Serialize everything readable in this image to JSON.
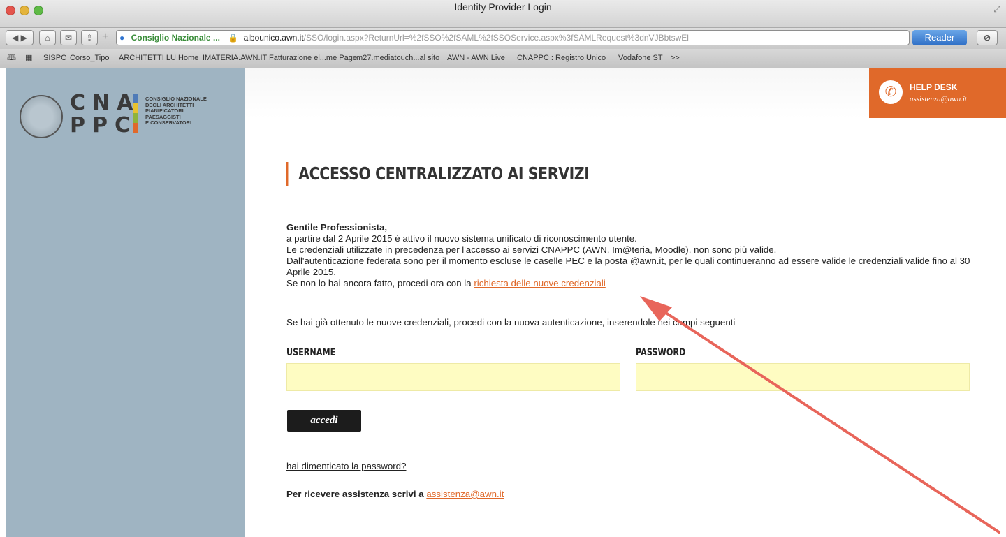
{
  "browser": {
    "window_title": "Identity Provider Login",
    "address": {
      "org": "Consiglio Nazionale ...",
      "host": "albounico.awn.it",
      "path": "/SSO/login.aspx?ReturnUrl=%2fSSO%2fSAML%2fSSOService.aspx%3fSAMLRequest%3dnVJBbtswEl"
    },
    "reader_label": "Reader",
    "bookmarks": [
      "SISPC",
      "Corso_Tipo",
      "ARCHITETTI LU Home",
      "IMATERIA.AWN.IT",
      "Fatturazione el...me Page",
      "m27.mediatouch...al sito",
      "AWN - AWN Live",
      "CNAPPC : Registro Unico",
      "Vodafone ST",
      ">>"
    ]
  },
  "logo": {
    "letters_top": "CNA",
    "letters_bottom": "PPC",
    "subtitle_lines": [
      "CONSIGLIO NAZIONALE",
      "DEGLI ARCHITETTI",
      "PIANIFICATORI",
      "PAESAGGISTI",
      "E CONSERVATORI"
    ],
    "bar_colors": [
      "#4f7bb8",
      "#e8c22e",
      "#8fb33a",
      "#e0692a"
    ]
  },
  "helpdesk": {
    "title": "HELP DESK",
    "email": "assistenza@awn.it"
  },
  "main": {
    "title": "ACCESSO CENTRALIZZATO AI SERVIZI",
    "greeting": "Gentile Professionista,",
    "p1": "a partire dal 2 Aprile 2015 è attivo il nuovo sistema unificato di riconoscimento utente.",
    "p2": "Le credenziali utilizzate in precedenza per l'accesso ai servizi CNAPPC (AWN, Im@teria, Moodle). non sono più valide.",
    "p3": "Dall'autenticazione federata sono per il momento escluse le caselle PEC e la posta @awn.it, per le quali continueranno ad essere valide le credenziali valide fino al 30 Aprile 2015.",
    "p4_prefix": "Se non lo hai ancora fatto, procedi ora con la ",
    "p4_link": "richiesta delle nuove credenziali",
    "p5": "Se hai già ottenuto le nuove credenziali, procedi con la nuova autenticazione, inserendole nei campi seguenti",
    "username_label": "USERNAME",
    "username_value": "",
    "password_label": "PASSWORD",
    "password_value": "",
    "submit_label": "accedi",
    "forgot_link": "hai dimenticato la password?",
    "assist_prefix": "Per ricevere assistenza scrivi a ",
    "assist_email": "assistenza@awn.it"
  },
  "colors": {
    "accent": "#e0692a",
    "sidebar": "#9fb4c2",
    "field": "#fefcc2",
    "annotation_arrow": "#e8655a"
  }
}
